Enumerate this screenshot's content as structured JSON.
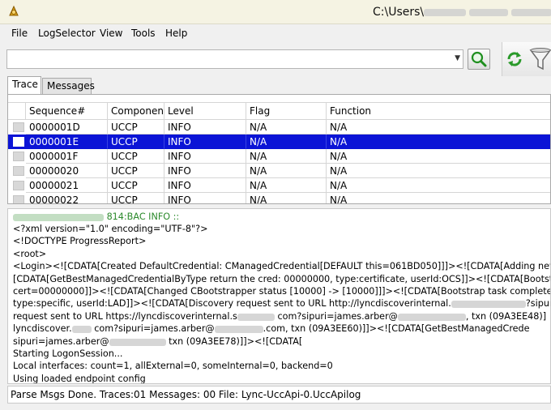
{
  "window": {
    "title": "C:\\Users\\"
  },
  "menu": {
    "items": [
      "File",
      "LogSelector",
      "View",
      "Tools",
      "Help"
    ]
  },
  "toolbar": {
    "search_value": "",
    "search_icon": "magnifier-icon",
    "refresh_icon": "refresh-icon",
    "filter_icon": "funnel-icon"
  },
  "tabs": [
    {
      "label": "Trace",
      "active": true
    },
    {
      "label": "Messages",
      "active": false
    }
  ],
  "grid": {
    "columns": [
      "Sequence#",
      "Componen",
      "Level",
      "Flag",
      "Function"
    ],
    "rows": [
      {
        "cells": [
          "0000001D",
          "UCCP",
          "INFO",
          "N/A",
          "N/A"
        ],
        "selected": false
      },
      {
        "cells": [
          "0000001E",
          "UCCP",
          "INFO",
          "N/A",
          "N/A"
        ],
        "selected": true
      },
      {
        "cells": [
          "0000001F",
          "UCCP",
          "INFO",
          "N/A",
          "N/A"
        ],
        "selected": false
      },
      {
        "cells": [
          "00000020",
          "UCCP",
          "INFO",
          "N/A",
          "N/A"
        ],
        "selected": false
      },
      {
        "cells": [
          "00000021",
          "UCCP",
          "INFO",
          "N/A",
          "N/A"
        ],
        "selected": false
      },
      {
        "cells": [
          "00000022",
          "UCCP",
          "INFO",
          "N/A",
          "N/A"
        ],
        "selected": false
      }
    ],
    "selection_color": "#0b14d6"
  },
  "detail": {
    "lines": [
      "814:BAC INFO  ::",
      "<?xml version=\"1.0\" encoding=\"UTF-8\"?>",
      "<!DOCTYPE ProgressReport>",
      "<root>",
      "  <Login><![CDATA[Created DefaultCredential: CManagedCredential[DEFAULT this=061BD050]]]><![CDATA[Adding new mar",
      "[CDATA[GetBestManagedCredentialByType return the cred: 00000000, type:certificate, userId:OCS]]><![CDATA[Bootstrap task",
      "cert=00000000]]><![CDATA[Changed CBootstrapper status [10000] -> [10000]]]><![CDATA[Bootstrap task completed with hr=",
      "type:specific, userId:LAD]]><![CDATA[Discovery request sent to URL http://lyncdiscoverinternal.",
      "request sent to URL https://lyncdiscoverinternal.s",
      "lyncdiscover.",
      "sipuri=james.arber@",
      "Starting LogonSession...",
      "   Local interfaces: count=1, allExternal=0, someInternal=0, backend=0",
      "   Using loaded endpoint config"
    ],
    "fragments": {
      "l7_tail": "?sipuri=jar",
      "l8_mid": "com?sipuri=james.arber@",
      "l8_tail": ", txn (09A3EE48)]",
      "l9_mid": "com?sipuri=james.arber@",
      "l9_mid2": ".com, txn (09A3EE60)]]><![CDATA[GetBestManagedCrede",
      "l10_tail": "txn (09A3EE78)]]><![CDATA["
    },
    "header_color": "#2c8a2c"
  },
  "status": {
    "text": "Parse Msgs Done. Traces:01 Messages: 00 File: Lync-UccApi-0.UccApilog"
  }
}
